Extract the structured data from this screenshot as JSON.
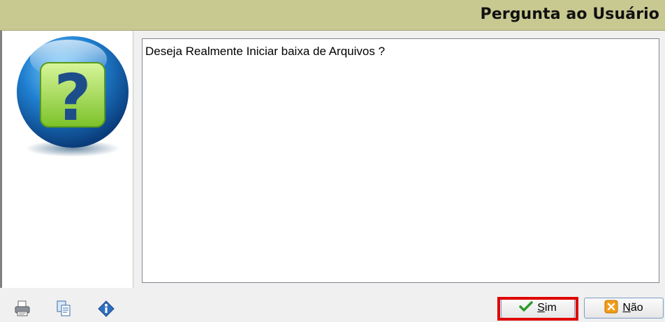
{
  "dialog": {
    "title": "Pergunta ao Usuário",
    "message": "Deseja Realmente Iniciar baixa de Arquivos ?"
  },
  "icons": {
    "main": "question-icon",
    "toolbar": [
      "printer-icon",
      "copy-icon",
      "info-icon"
    ]
  },
  "buttons": {
    "sim": {
      "label_first": "S",
      "label_rest": "im",
      "icon": "checkmark-icon",
      "highlighted": true,
      "highlight_color": "#e00000"
    },
    "nao": {
      "label_first": "N",
      "label_rest": "ão",
      "icon": "x-icon"
    }
  },
  "colors": {
    "titlebar": "#c8c891",
    "checkmark": "#2e9b2e",
    "x_button": "#f39c12"
  }
}
